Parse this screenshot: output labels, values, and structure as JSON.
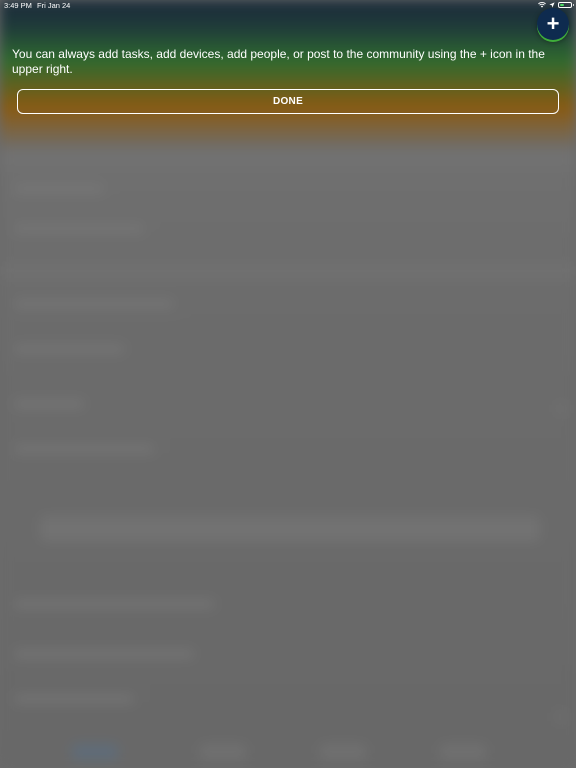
{
  "status_bar": {
    "time": "3:49 PM",
    "date": "Fri Jan 24",
    "battery_level": 0.4,
    "battery_color": "#4cd964"
  },
  "add_button": {
    "icon": "plus-icon",
    "glyph": "+",
    "background": "#0e2b4f"
  },
  "coach_mark": {
    "message": "You can always add tasks, add devices, add people, or post to the community using the + icon in the upper right.",
    "done_label": "DONE"
  },
  "colors": {
    "header_dark": "#1b2a3a",
    "header_green": "#2f6a2f",
    "header_orange": "#8a5a12",
    "overlay_gray": "#6a6a6a"
  }
}
